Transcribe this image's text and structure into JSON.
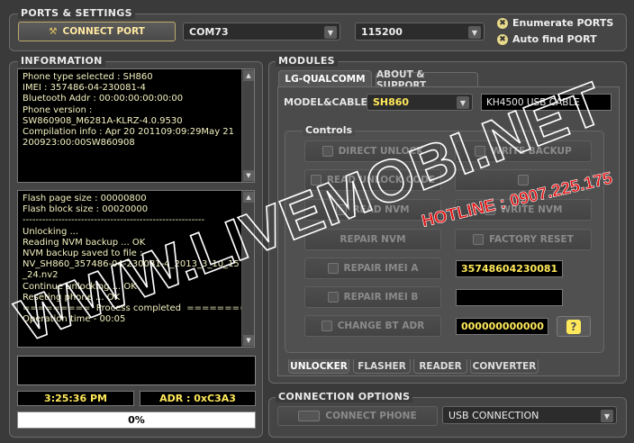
{
  "ports": {
    "title": "PORTS & SETTINGS",
    "connect_label": "CONNECT PORT",
    "port_value": "COM73",
    "baud_value": "115200",
    "enumerate_label": "Enumerate PORTS",
    "autofind_label": "Auto find PORT"
  },
  "information": {
    "title": "INFORMATION",
    "info_lines": [
      "Phone type selected : SH860",
      "IMEI : 357486-04-230081-4",
      "Bluetooth Addr : 00:00:00:00:00:00",
      "Phone version :",
      "SW860908_M6281A-KLRZ-4.0.9530",
      "Compilation info : Apr 20 201109:09:29May 21",
      "200923:00:00SW860908"
    ],
    "log_lines": [
      "Flash page size : 00000800",
      "Flash block size : 00020000",
      "--------------------------------------------------------",
      "Unlocking ...",
      "Reading NVM backup ... OK",
      "NVM backup saved to file :",
      "NV_SH860_357486-04-230081-4_2013_3_10_15",
      "_24.nv2",
      "Continue unlocking ... OK",
      "Reseting phone ... OK",
      "=========  Process completed  ========",
      "Operation time - 00:05"
    ],
    "time": "3:25:36 PM",
    "adr": "ADR : 0xC3A3",
    "progress_text": "0%",
    "progress": 0
  },
  "modules": {
    "title": "MODULES",
    "tabs": [
      "LG-QUALCOMM",
      "ABOUT & SUPPORT"
    ],
    "model_label": "MODEL&CABLE :",
    "model_value": "SH860",
    "cable_value": "KH4500 USB CABLE",
    "controls_title": "Controls",
    "buttons": {
      "direct_unlock": "DIRECT UNLOCK",
      "write_backup": "WRITE BACKUP",
      "read_unlock_code": "READ UNLOCK CODE",
      "read_nvm": "READ NVM",
      "write_nvm": "WRITE NVM",
      "repair_nvm": "REPAIR NVM",
      "factory_reset": "FACTORY RESET",
      "repair_imei_a": "REPAIR IMEI A",
      "repair_imei_b": "REPAIR IMEI B",
      "change_bt_adr": "CHANGE BT ADR",
      "help": "?"
    },
    "imei_a_value": "35748604230081",
    "imei_b_value": "",
    "bt_value": "000000000000",
    "bottom_tabs": [
      "UNLOCKER",
      "FLASHER",
      "READER",
      "CONVERTER"
    ]
  },
  "connection": {
    "title": "CONNECTION OPTIONS",
    "connect_phone_label": "CONNECT PHONE",
    "connection_value": "USB CONNECTION"
  },
  "watermark": {
    "site": "WWW.LIVEMOBI.NET",
    "hotline": "HOTLINE : 0907.225.175"
  },
  "colors": {
    "accent_yellow": "#ffe95a",
    "console_text": "#f4f2c0",
    "watermark_red": "#e01010"
  }
}
